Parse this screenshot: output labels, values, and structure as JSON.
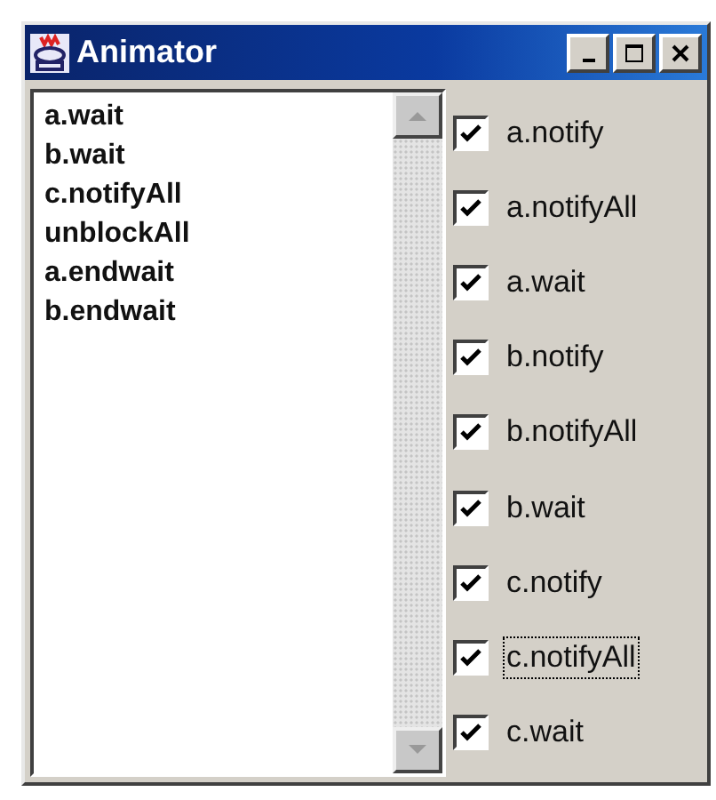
{
  "window": {
    "title": "Animator"
  },
  "list": {
    "items": [
      "a.wait",
      "b.wait",
      "c.notifyAll",
      "unblockAll",
      "a.endwait",
      "b.endwait"
    ]
  },
  "checkboxes": [
    {
      "label": "a.notify",
      "checked": true,
      "focused": false
    },
    {
      "label": "a.notifyAll",
      "checked": true,
      "focused": false
    },
    {
      "label": "a.wait",
      "checked": true,
      "focused": false
    },
    {
      "label": "b.notify",
      "checked": true,
      "focused": false
    },
    {
      "label": "b.notifyAll",
      "checked": true,
      "focused": false
    },
    {
      "label": "b.wait",
      "checked": true,
      "focused": false
    },
    {
      "label": "c.notify",
      "checked": true,
      "focused": false
    },
    {
      "label": "c.notifyAll",
      "checked": true,
      "focused": true
    },
    {
      "label": "c.wait",
      "checked": true,
      "focused": false
    }
  ]
}
